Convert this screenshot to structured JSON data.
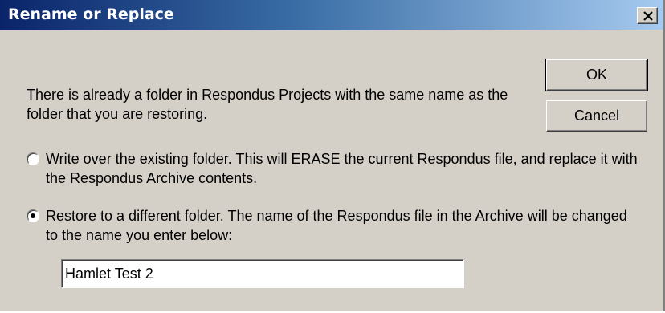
{
  "window": {
    "title": "Rename or Replace",
    "close_glyph": "×",
    "close_icon": "close-icon"
  },
  "message": "There is already a folder in Respondus Projects with the same name as the folder that you are restoring.",
  "buttons": {
    "ok_label": "OK",
    "cancel_label": "Cancel"
  },
  "options": [
    {
      "label": "Write over the existing folder.  This will ERASE the current Respondus file, and replace it with the Respondus Archive contents.",
      "selected": false
    },
    {
      "label": "Restore to a different folder.  The name of the Respondus file in the Archive will be changed to the name you enter below:",
      "selected": true
    }
  ],
  "new_folder_name": {
    "value": "Hamlet Test 2"
  },
  "colors": {
    "dialog_bg": "#d4d0c8",
    "titlebar_start": "#0a246a",
    "titlebar_end": "#a6caf0"
  }
}
